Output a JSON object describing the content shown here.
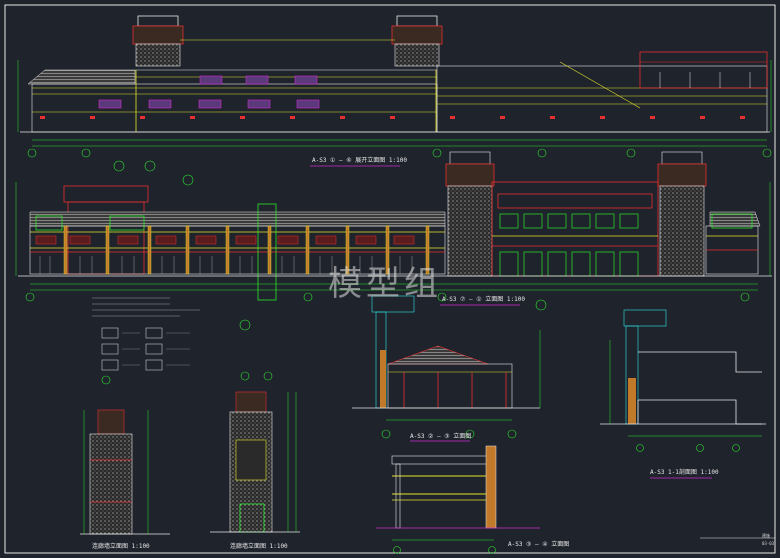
{
  "watermark": "模型组",
  "drawing_titles": {
    "elevation_1": "A-S3 ① — ⑥ 展开立面图 1:100",
    "elevation_2": "A-S3 ⑦ — ① 立面图 1:100",
    "elevation_3": "A-S3 ② — ③ 立面图",
    "section": "A-S3 1-1剖面图 1:100",
    "pavilion": "A-S3 ③ — ④ 立面图",
    "detail_1": "连廊墙立面图 1:100",
    "detail_2": "连廊墙立面图 1:100"
  },
  "sheet": {
    "number": "建施",
    "code": "03-03"
  },
  "colors": {
    "background": "#1f232c",
    "yellow": "#e6e62c",
    "green": "#2ee62e",
    "red": "#e63030",
    "cyan": "#2ce6e6",
    "magenta": "#d02ad0",
    "white": "#e8e8e8",
    "grey": "#9a9a9a"
  }
}
